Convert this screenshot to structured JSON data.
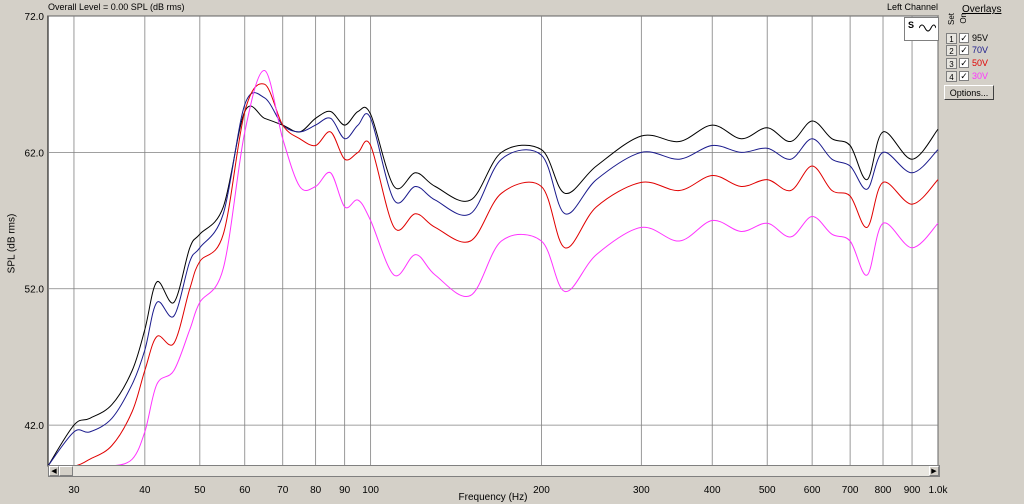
{
  "header": {
    "left": "Overall Level = 0.00 SPL (dB rms)",
    "right": "Left Channel"
  },
  "axis": {
    "ylabel": "SPL (dB rms)",
    "xlabel": "Frequency (Hz)",
    "yticks": [
      "72.0",
      "62.0",
      "52.0",
      "42.0"
    ],
    "xticks": [
      "30",
      "40",
      "50",
      "60",
      "70",
      "80",
      "90",
      "100",
      "200",
      "300",
      "400",
      "500",
      "600",
      "700",
      "800",
      "900",
      "1.0k"
    ]
  },
  "logo": {
    "letters": "S",
    "wave": "A"
  },
  "overlays": {
    "title": "Overlays",
    "col_set": "Set",
    "col_on": "On",
    "rows": [
      {
        "num": "1",
        "checked": "✓",
        "label": "95V",
        "color": "#000000"
      },
      {
        "num": "2",
        "checked": "✓",
        "label": "70V",
        "color": "#1a1a8c"
      },
      {
        "num": "3",
        "checked": "✓",
        "label": "50V",
        "color": "#e00000"
      },
      {
        "num": "4",
        "checked": "✓",
        "label": "30V",
        "color": "#ff33ff"
      }
    ],
    "options_label": "Options..."
  },
  "chart_data": {
    "type": "line",
    "xscale": "log",
    "xlim": [
      27,
      1000
    ],
    "ylim": [
      39,
      72
    ],
    "series": [
      {
        "name": "95V",
        "color": "#000000",
        "x": [
          27,
          30,
          32,
          35,
          38,
          40,
          42,
          45,
          48,
          50,
          55,
          60,
          65,
          70,
          75,
          80,
          85,
          90,
          95,
          100,
          110,
          120,
          130,
          150,
          170,
          200,
          220,
          250,
          300,
          350,
          400,
          450,
          500,
          550,
          600,
          650,
          700,
          750,
          800,
          900,
          1000
        ],
        "y": [
          39,
          42,
          42.5,
          43.5,
          46,
          49,
          52.5,
          51,
          55,
          56,
          58,
          65,
          64.5,
          64,
          63.5,
          64.5,
          65,
          64,
          65,
          64.8,
          59.5,
          60.5,
          59.5,
          58.5,
          62,
          62.2,
          59,
          61,
          63.2,
          62.8,
          64,
          63,
          63.8,
          62.8,
          64.3,
          63,
          62.5,
          60,
          63.5,
          61.5,
          63.7
        ]
      },
      {
        "name": "70V",
        "color": "#1a1a8c",
        "x": [
          27,
          30,
          32,
          35,
          38,
          40,
          42,
          45,
          48,
          50,
          55,
          60,
          65,
          70,
          75,
          80,
          85,
          90,
          95,
          100,
          110,
          120,
          130,
          150,
          170,
          200,
          220,
          250,
          300,
          350,
          400,
          450,
          500,
          550,
          600,
          650,
          700,
          750,
          800,
          900,
          1000
        ],
        "y": [
          39,
          41.5,
          41.5,
          42.5,
          45,
          47.5,
          51,
          50,
          54,
          55,
          57.5,
          65.5,
          66,
          64,
          63.5,
          64,
          64.5,
          63,
          64,
          64.5,
          58.5,
          59.5,
          58.5,
          57.5,
          61.5,
          61.8,
          57.5,
          60,
          62,
          61.5,
          62.5,
          62,
          62.3,
          61.5,
          63,
          61.5,
          61,
          59.3,
          62,
          60.5,
          62.2
        ]
      },
      {
        "name": "50V",
        "color": "#e00000",
        "x": [
          27,
          30,
          32,
          35,
          38,
          40,
          42,
          45,
          48,
          50,
          55,
          60,
          65,
          70,
          75,
          80,
          85,
          90,
          95,
          100,
          110,
          120,
          130,
          150,
          170,
          200,
          220,
          250,
          300,
          350,
          400,
          450,
          500,
          550,
          600,
          650,
          700,
          750,
          800,
          900,
          1000
        ],
        "y": [
          39,
          39,
          39.5,
          40.5,
          43,
          46,
          48.5,
          48,
          52,
          54,
          56,
          65,
          67,
          64,
          63,
          62.5,
          63.5,
          61.5,
          62,
          62.5,
          56.5,
          57.5,
          56.5,
          55.5,
          59,
          59.5,
          55,
          58,
          59.8,
          59.2,
          60.3,
          59.5,
          60,
          59.2,
          61,
          59.2,
          58.8,
          56.5,
          59.8,
          58.2,
          60
        ]
      },
      {
        "name": "30V",
        "color": "#ff33ff",
        "x": [
          27,
          30,
          32,
          35,
          38,
          40,
          42,
          45,
          48,
          50,
          55,
          60,
          65,
          70,
          75,
          80,
          85,
          90,
          95,
          100,
          110,
          120,
          130,
          150,
          170,
          200,
          220,
          250,
          300,
          350,
          400,
          450,
          500,
          550,
          600,
          650,
          700,
          750,
          800,
          900,
          1000
        ],
        "y": [
          39,
          39,
          39,
          39,
          39.5,
          41.5,
          45,
          46,
          49,
          51,
          53.5,
          63.5,
          68,
          63,
          59.5,
          59.5,
          60.5,
          58,
          58.5,
          57,
          53,
          54.5,
          53,
          51.5,
          55.5,
          55.5,
          51.8,
          54.5,
          56.5,
          55.5,
          57,
          56.2,
          56.8,
          55.8,
          57.3,
          56,
          55.5,
          53,
          56.8,
          55,
          56.8
        ]
      }
    ]
  }
}
